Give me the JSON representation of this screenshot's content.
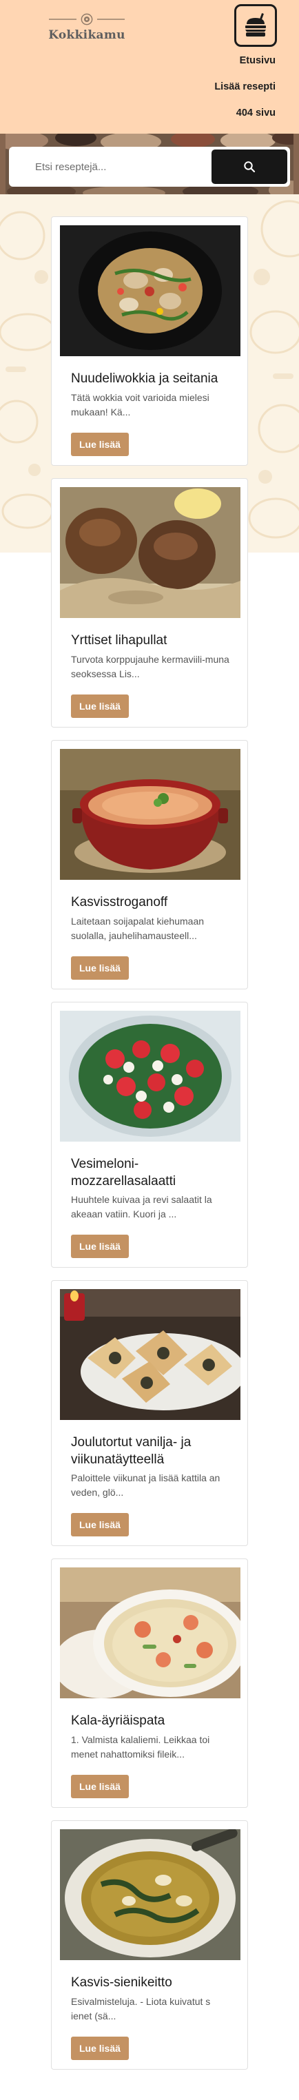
{
  "header": {
    "logo_text": "Kokkikamu",
    "menu_icon": "burger-icon",
    "nav": [
      {
        "label": "Etusivu"
      },
      {
        "label": "Lisää resepti"
      },
      {
        "label": "404 sivu"
      }
    ]
  },
  "search": {
    "placeholder": "Etsi reseptejä...",
    "button_icon": "search-icon"
  },
  "colors": {
    "header_bg": "#ffd6b3",
    "button_bg": "#c49262",
    "search_button_bg": "#171717"
  },
  "recipes": [
    {
      "title": "Nuudeliwokkia ja seitania",
      "excerpt": "Tätä wokkia voit varioida mielesi mukaan! Kä...",
      "button": "Lue lisää",
      "image": "wok-noodles-photo"
    },
    {
      "title": "Yrttiset lihapullat",
      "excerpt": "Turvota korppujauhe kermaviili-muna seoksessa Lis...",
      "button": "Lue lisää",
      "image": "meatballs-photo"
    },
    {
      "title": "Kasvisstroganoff",
      "excerpt": "Laitetaan soijapalat kiehumaan suolalla, jauhelihamausteell...",
      "button": "Lue lisää",
      "image": "stroganoff-pot-photo"
    },
    {
      "title": "Vesimeloni-mozzarellasalaatti",
      "excerpt": "Huuhtele kuivaa ja revi salaatit la akeaan vatiin. Kuori ja ...",
      "button": "Lue lisää",
      "image": "watermelon-salad-photo"
    },
    {
      "title": "Joulutortut vanilja- ja viikunatäytteellä",
      "excerpt": "Paloittele viikunat ja lisää kattila an veden, glö...",
      "button": "Lue lisää",
      "image": "christmas-pastries-photo"
    },
    {
      "title": "Kala-äyriäispata",
      "excerpt": "1. Valmista kalaliemi. Leikkaa toi menet nahattomiksi fileik...",
      "button": "Lue lisää",
      "image": "seafood-stew-photo"
    },
    {
      "title": "Kasvis-sienikeitto",
      "excerpt": "Esivalmisteluja. - Liota kuivatut s ienet (sä...",
      "button": "Lue lisää",
      "image": "mushroom-soup-photo"
    }
  ]
}
